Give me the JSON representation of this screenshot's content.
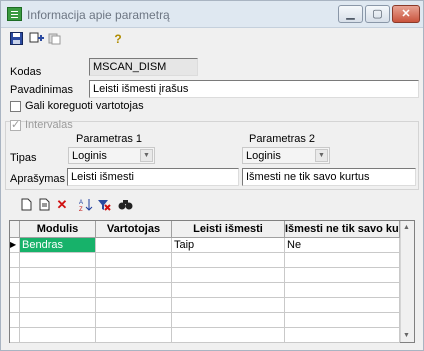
{
  "window": {
    "title": "Informacija apie parametrą"
  },
  "toolbar": {
    "help_symbol": "?"
  },
  "form": {
    "kodas_label": "Kodas",
    "kodas_value": "MSCAN_DISM",
    "pavadinimas_label": "Pavadinimas",
    "pavadinimas_value": "Leisti išmesti įrašus",
    "gali_koreguoti_label": "Gali koreguoti vartotojas",
    "intervalas_label": "Intervalas",
    "parametras1_label": "Parametras 1",
    "parametras2_label": "Parametras 2",
    "tipas_label": "Tipas",
    "tipas1_value": "Loginis",
    "tipas2_value": "Loginis",
    "aprasymas_label": "Aprašymas",
    "aprasymas1_value": "Leisti išmesti",
    "aprasymas2_value": "Išmesti ne tik savo kurtus"
  },
  "grid": {
    "columns": [
      "Modulis",
      "Vartotojas",
      "Leisti išmesti",
      "Išmesti ne tik savo kurtus"
    ],
    "rows": [
      {
        "modulis": "Bendras",
        "vartotojas": "",
        "leisti": "Taip",
        "ismesti": "Ne"
      }
    ]
  }
}
